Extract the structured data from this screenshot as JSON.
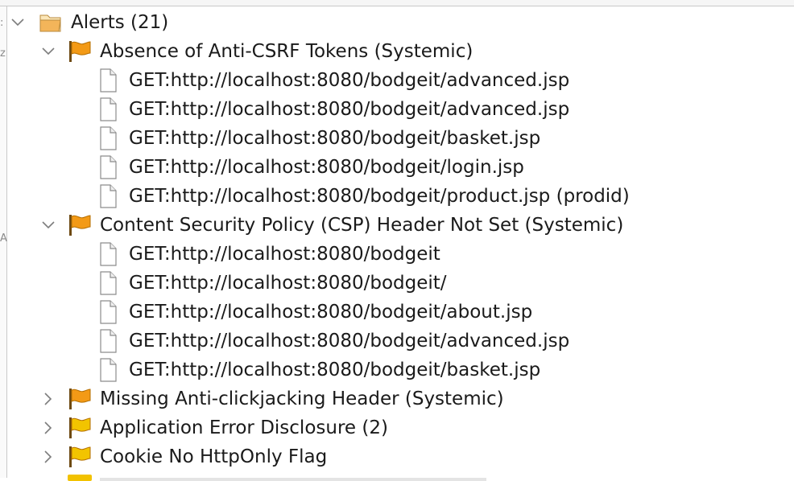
{
  "tree": {
    "root": {
      "label": "Alerts (21)",
      "expanded": true,
      "icon": "folder-icon"
    },
    "groups": [
      {
        "label": "Absence of Anti-CSRF Tokens (Systemic)",
        "expanded": true,
        "flag": "orange",
        "children": [
          "GET:http://localhost:8080/bodgeit/advanced.jsp",
          "GET:http://localhost:8080/bodgeit/advanced.jsp",
          "GET:http://localhost:8080/bodgeit/basket.jsp",
          "GET:http://localhost:8080/bodgeit/login.jsp",
          "GET:http://localhost:8080/bodgeit/product.jsp (prodid)"
        ]
      },
      {
        "label": "Content Security Policy (CSP) Header Not Set (Systemic)",
        "expanded": true,
        "flag": "orange",
        "children": [
          "GET:http://localhost:8080/bodgeit",
          "GET:http://localhost:8080/bodgeit/",
          "GET:http://localhost:8080/bodgeit/about.jsp",
          "GET:http://localhost:8080/bodgeit/advanced.jsp",
          "GET:http://localhost:8080/bodgeit/basket.jsp"
        ]
      },
      {
        "label": "Missing Anti-clickjacking Header (Systemic)",
        "expanded": false,
        "flag": "orange",
        "children": []
      },
      {
        "label": "Application Error Disclosure (2)",
        "expanded": false,
        "flag": "yellow",
        "children": []
      },
      {
        "label": "Cookie No HttpOnly Flag",
        "expanded": false,
        "flag": "yellow",
        "children": []
      }
    ]
  },
  "gutter": {
    "glyphs": [
      ":",
      "z",
      "A"
    ]
  },
  "colors": {
    "flag_orange": "#f39a16",
    "flag_yellow": "#f2c400",
    "folder": "#f3b55a",
    "chevron": "#7d7d7d",
    "text": "#1a1a1a"
  }
}
